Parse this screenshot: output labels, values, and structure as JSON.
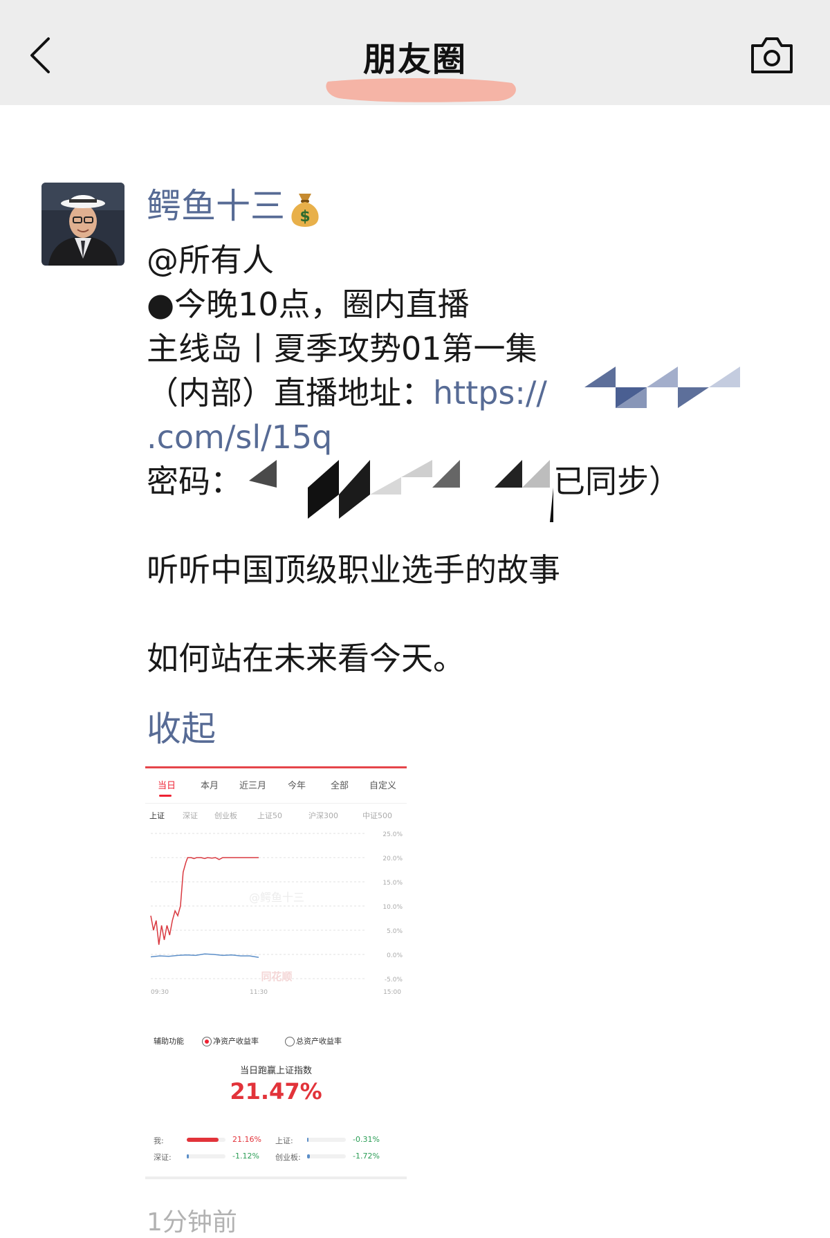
{
  "header": {
    "title": "朋友圈",
    "back_icon": "chevron-left-icon",
    "camera_icon": "camera-icon",
    "bg": "#ededed"
  },
  "post": {
    "author": "鳄鱼十三",
    "author_emoji": "💰",
    "lines": {
      "mention": "@所有人",
      "l1": "●今晚10点，圈内直播",
      "l2": "主线岛丨夏季攻势01第一集",
      "l3_prefix": "（内部）直播地址：",
      "l3_link": "https://",
      "l4_link": ".com/sl/15q",
      "l5_prefix": "密码：",
      "l5_suffix": "已同步）",
      "l6": "听听中国顶级职业选手的故事",
      "l7": "如何站在未来看今天。"
    },
    "collapse_label": "收起",
    "time_fragment": "1分钟前"
  },
  "screenshot": {
    "tabs": [
      "当日",
      "本月",
      "近三月",
      "今年",
      "全部",
      "自定义"
    ],
    "active_tab": "当日",
    "indices": [
      "上证",
      "深证",
      "创业板",
      "上证50",
      "沪深300",
      "中证500"
    ],
    "active_index": "上证",
    "watermark": "@鳄鱼十三",
    "brand_watermark": "同花顺",
    "aux_label": "辅助功能",
    "radio_net": "净资产收益率",
    "radio_total": "总资产收益率",
    "beat_label": "当日跑赢上证指数",
    "beat_value": "21.47%",
    "comparisons": {
      "me_label": "我:",
      "me_value": "21.16%",
      "sh_label": "上证:",
      "sh_value": "-0.31%",
      "sz_label": "深证:",
      "sz_value": "-1.12%",
      "cy_label": "创业板:",
      "cy_value": "-1.72%"
    },
    "chart_data": {
      "type": "line",
      "y_ticks": [
        "25.0%",
        "20.0%",
        "15.0%",
        "10.0%",
        "5.0%",
        "0.0%",
        "-5.0%"
      ],
      "x_ticks": [
        "09:30",
        "11:30",
        "15:00"
      ],
      "ylim": [
        -5,
        25
      ],
      "series": [
        {
          "name": "我",
          "color": "#d9383f",
          "points": [
            [
              0,
              8
            ],
            [
              3,
              5
            ],
            [
              6,
              7
            ],
            [
              9,
              2
            ],
            [
              12,
              6
            ],
            [
              15,
              3
            ],
            [
              18,
              6
            ],
            [
              21,
              4
            ],
            [
              24,
              7
            ],
            [
              27,
              9
            ],
            [
              30,
              8
            ],
            [
              33,
              10
            ],
            [
              36,
              17
            ],
            [
              39,
              19
            ],
            [
              41,
              20
            ],
            [
              45,
              20
            ],
            [
              48,
              19.8
            ],
            [
              51,
              20
            ],
            [
              56,
              20
            ],
            [
              60,
              19.8
            ],
            [
              63,
              20
            ],
            [
              68,
              19.9
            ],
            [
              72,
              20
            ],
            [
              76,
              19.6
            ],
            [
              80,
              20
            ],
            [
              90,
              20
            ],
            [
              100,
              20
            ],
            [
              110,
              20
            ],
            [
              120,
              20
            ]
          ]
        },
        {
          "name": "上证",
          "color": "#5b8ec8",
          "points": [
            [
              0,
              -0.5
            ],
            [
              10,
              -0.3
            ],
            [
              20,
              -0.4
            ],
            [
              30,
              -0.2
            ],
            [
              40,
              -0.1
            ],
            [
              50,
              -0.2
            ],
            [
              60,
              0.1
            ],
            [
              70,
              0.0
            ],
            [
              80,
              -0.2
            ],
            [
              90,
              -0.1
            ],
            [
              100,
              -0.3
            ],
            [
              110,
              -0.3
            ],
            [
              120,
              -0.6
            ]
          ]
        }
      ],
      "x_span_minutes": 240
    }
  }
}
